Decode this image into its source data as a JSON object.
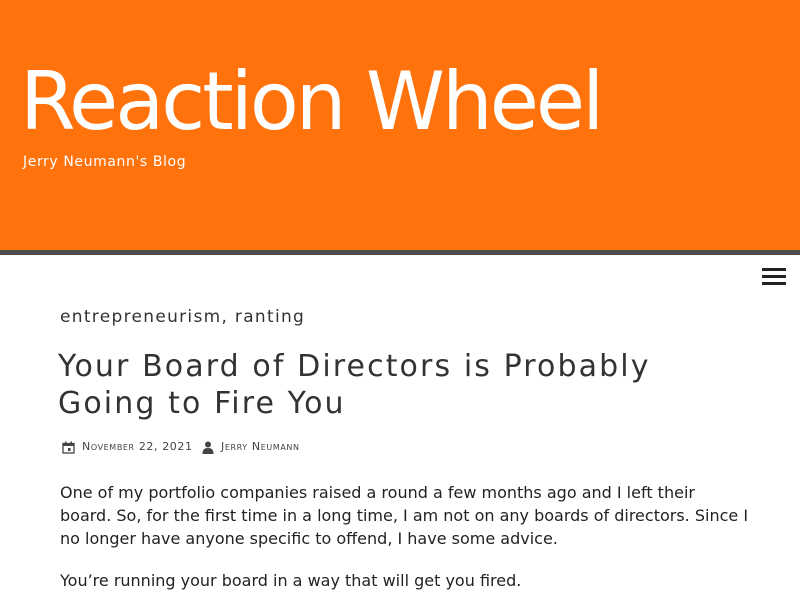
{
  "site": {
    "title": "Reaction Wheel",
    "tagline": "Jerry Neumann's Blog"
  },
  "nav": {
    "menu_icon": "hamburger-menu-icon"
  },
  "post": {
    "categories": [
      "entrepreneurism",
      "ranting"
    ],
    "category_separator": ", ",
    "title": "Your Board of Directors is Probably Going to Fire You",
    "date": "November 22, 2021",
    "date_icon": "calendar-icon",
    "author": "Jerry Neumann",
    "author_icon": "person-icon",
    "paragraphs": [
      "One of my portfolio companies raised a round a few months ago and I left their board. So, for the first time in a long time, I am not on any boards of directors. Since I no longer have anyone specific to offend, I have some advice.",
      "You’re running your board in a way that will get you fired."
    ]
  },
  "colors": {
    "header_background": "#ff720c",
    "nav_bar": "#4c4c4c",
    "text": "#333333"
  }
}
